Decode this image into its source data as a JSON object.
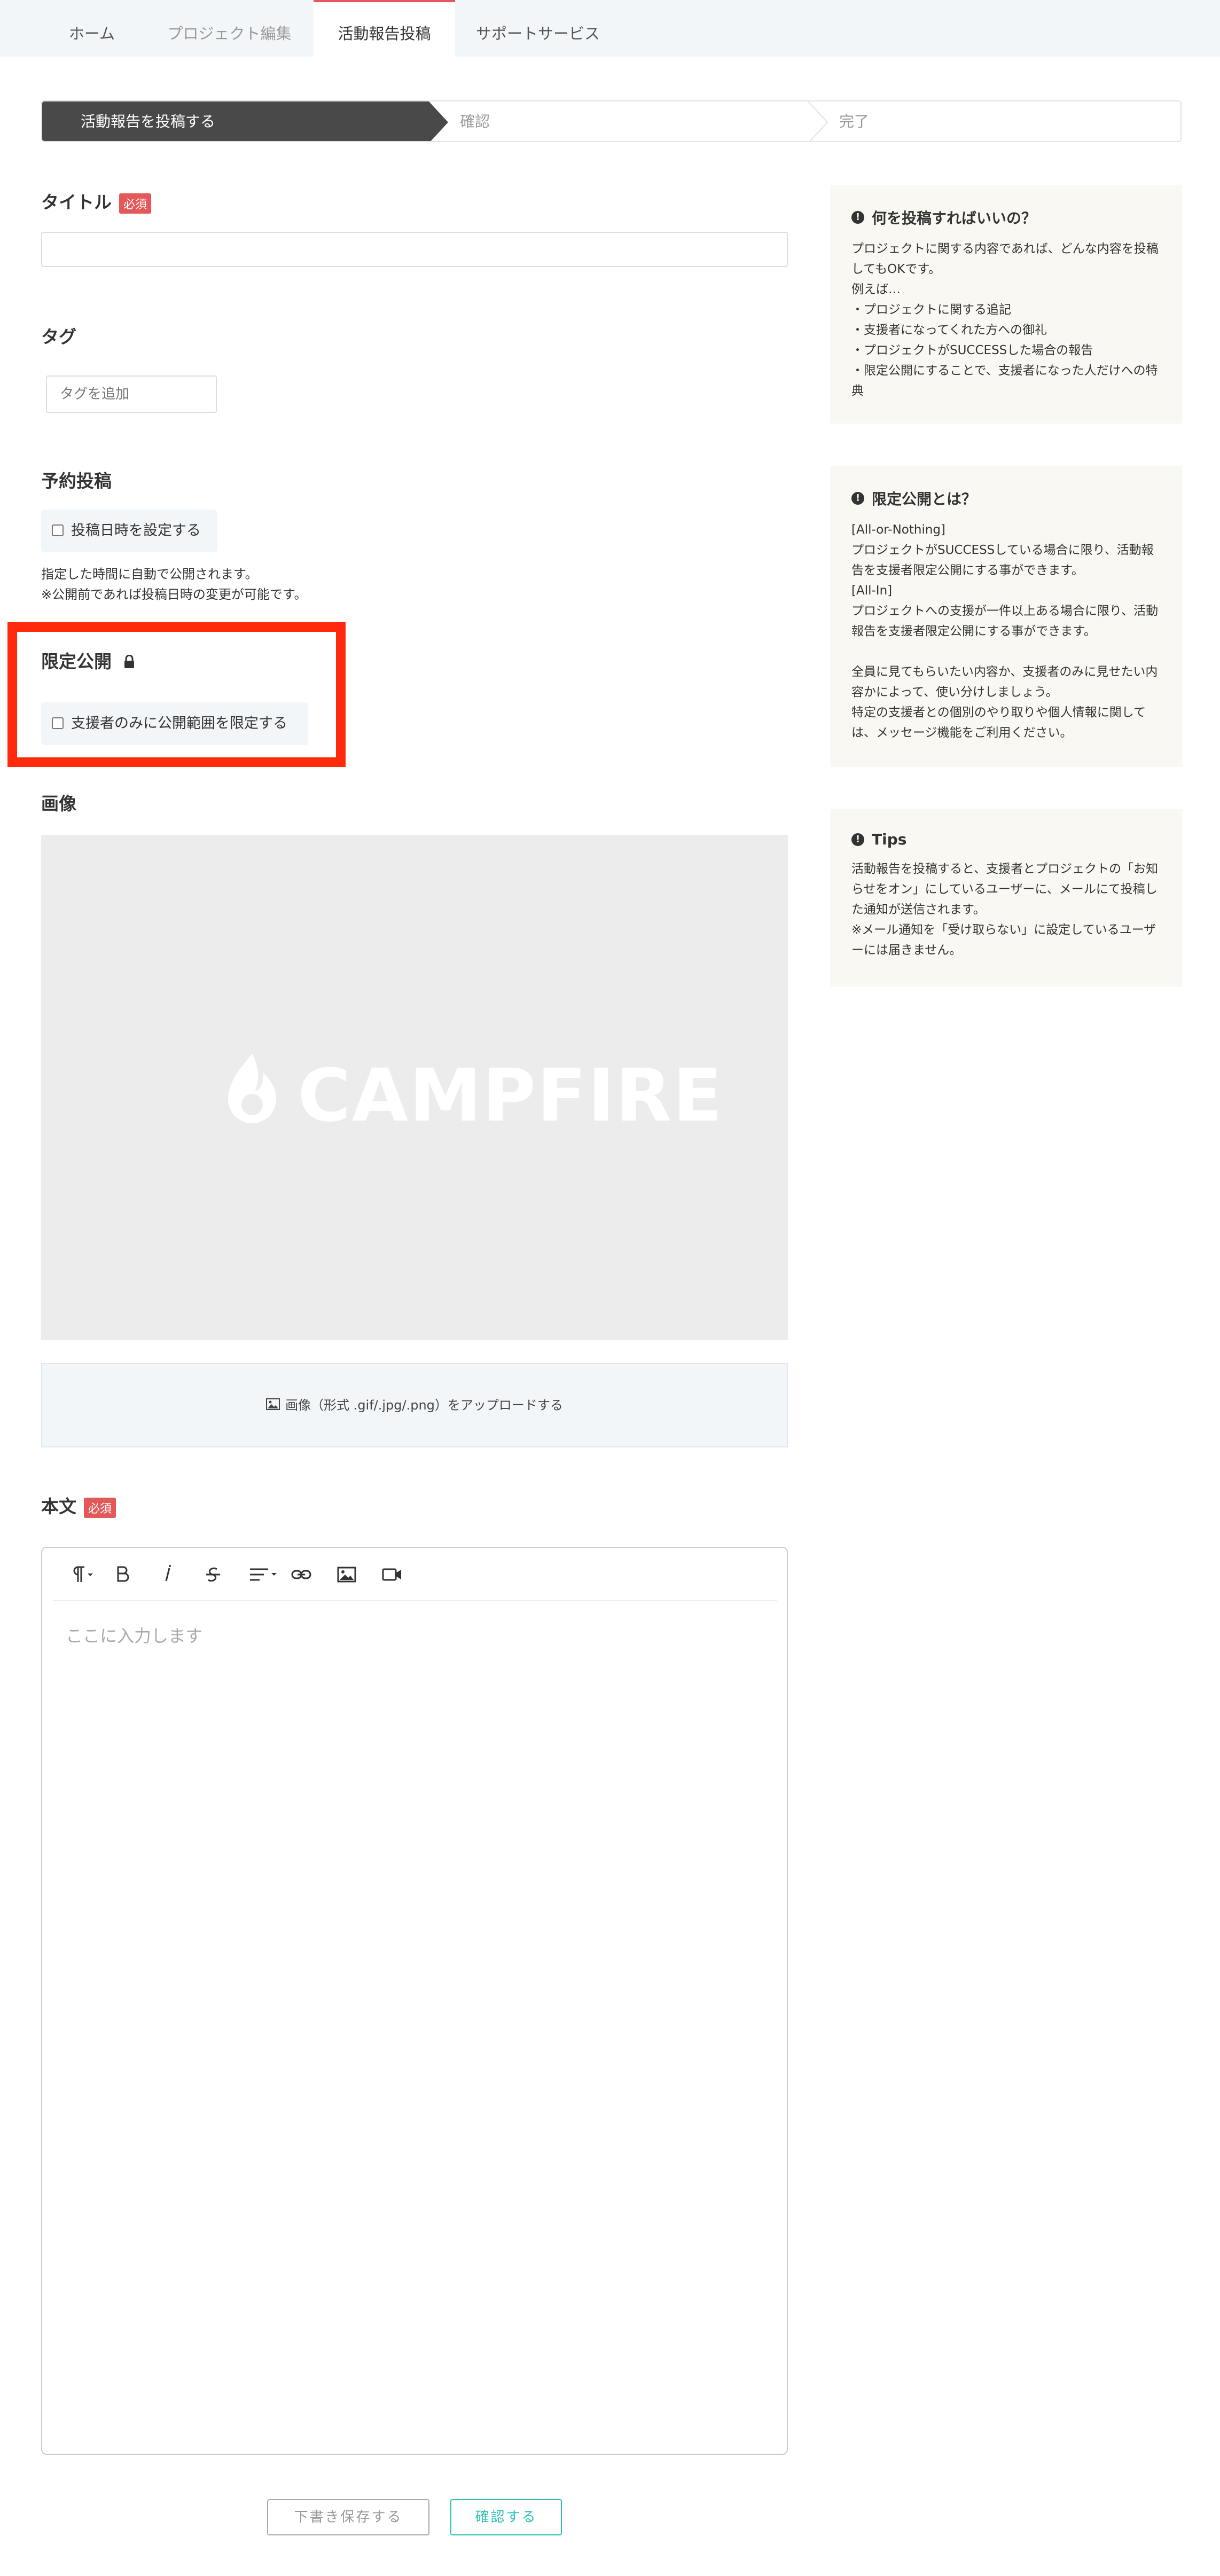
{
  "tabs": [
    "ホーム",
    "プロジェクト編集",
    "活動報告投稿",
    "サポートサービス"
  ],
  "steps": [
    "活動報告を投稿する",
    "確認",
    "完了"
  ],
  "form": {
    "title_label": "タイトル",
    "required_badge": "必須",
    "tag_label": "タグ",
    "tag_placeholder": "タグを追加",
    "schedule_label": "予約投稿",
    "schedule_checkbox": "投稿日時を設定する",
    "schedule_note": "指定した時間に自動で公開されます。\n※公開前であれば投稿日時の変更が可能です。",
    "limited_label": "限定公開",
    "limited_checkbox": "支援者のみに公開範囲を限定する",
    "image_label": "画像",
    "image_logo_text": "CAMPFIRE",
    "upload_text": "画像（形式 .gif/.jpg/.png）をアップロードする",
    "body_label": "本文",
    "body_placeholder": "ここに入力します",
    "draft_button": "下書き保存する",
    "confirm_button": "確認する"
  },
  "editor_tools": [
    "paragraph-icon",
    "bold-icon",
    "italic-icon",
    "strikethrough-icon",
    "align-icon",
    "link-icon",
    "image-icon",
    "video-icon"
  ],
  "sidebar": [
    {
      "title": "何を投稿すればいいの？",
      "body": "プロジェクトに関する内容であれば、どんな内容を投稿してもOKです。\n例えば…\n・プロジェクトに関する追記\n・支援者になってくれた方への御礼\n・プロジェクトがSUCCESSした場合の報告\n・限定公開にすることで、支援者になった人だけへの特典"
    },
    {
      "title": "限定公開とは？",
      "body": "[All-or-Nothing]\nプロジェクトがSUCCESSしている場合に限り、活動報告を支援者限定公開にする事ができます。\n[All-In]\nプロジェクトへの支援が一件以上ある場合に限り、活動報告を支援者限定公開にする事ができます。\n\n全員に見てもらいたい内容か、支援者のみに見せたい内容かによって、使い分けしましょう。\n特定の支援者との個別のやり取りや個人情報に関しては、メッセージ機能をご利用ください。"
    },
    {
      "title": "Tips",
      "body": "活動報告を投稿すると、支援者とプロジェクトの「お知らせをオン」にしているユーザーに、メールにて投稿した通知が送信されます。\n※メール通知を「受け取らない」に設定しているユーザーには届きません。"
    }
  ],
  "colors": {
    "accent_red": "#e4585a",
    "highlight": "#ff2a0c",
    "confirm_teal": "#28c2b4",
    "step_active": "#494949"
  }
}
